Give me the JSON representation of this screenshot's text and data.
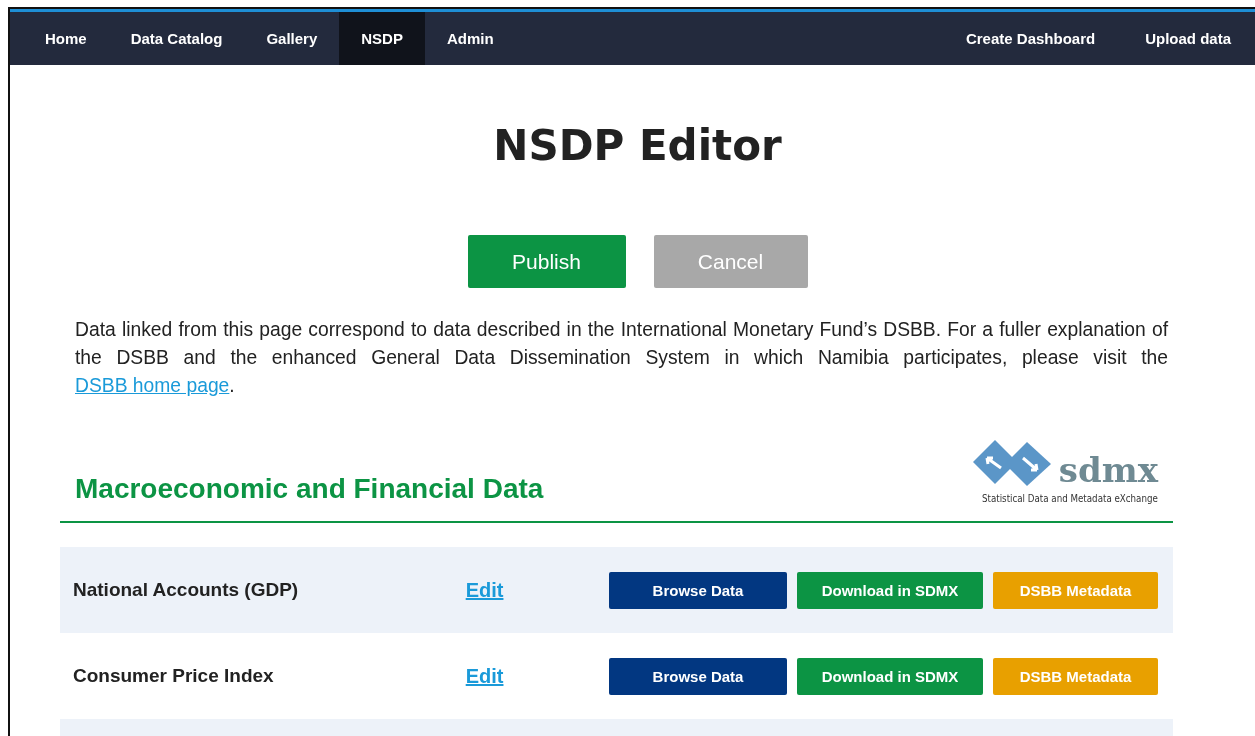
{
  "nav": {
    "left": [
      {
        "label": "Home",
        "selected": false
      },
      {
        "label": "Data Catalog",
        "selected": false
      },
      {
        "label": "Gallery",
        "selected": false
      },
      {
        "label": "NSDP",
        "selected": true
      },
      {
        "label": "Admin",
        "selected": false
      }
    ],
    "right": [
      {
        "label": "Create Dashboard",
        "selected": false
      },
      {
        "label": "Upload data",
        "selected": false
      }
    ]
  },
  "title": "NSDP Editor",
  "actions": [
    {
      "label": "Publish",
      "kind": "primary"
    },
    {
      "label": "Cancel",
      "kind": "secondary"
    }
  ],
  "intro": {
    "text": "Data linked from this page correspond to data described in the International Monetary Fund’s DSBB. For a fuller explanation of the DSBB and the enhanced General Data Dissemination System in which Namibia participates, please visit the ",
    "link": "DSBB home page",
    "after": "."
  },
  "section": {
    "heading": "Macroeconomic and Financial Data",
    "logo": {
      "wordmark": "sdmx",
      "tagline": "Statistical Data and Metadata eXchange"
    }
  },
  "rows": [
    {
      "name": "National Accounts (GDP)",
      "edit": "Edit",
      "buttons": [
        {
          "label": "Browse Data",
          "kind": "browse"
        },
        {
          "label": "Download in SDMX",
          "kind": "download"
        },
        {
          "label": "DSBB Metadata",
          "kind": "metadata"
        }
      ]
    },
    {
      "name": "Consumer Price Index",
      "edit": "Edit",
      "buttons": [
        {
          "label": "Browse Data",
          "kind": "browse"
        },
        {
          "label": "Download in SDMX",
          "kind": "download"
        },
        {
          "label": "DSBB Metadata",
          "kind": "metadata"
        }
      ]
    }
  ]
}
